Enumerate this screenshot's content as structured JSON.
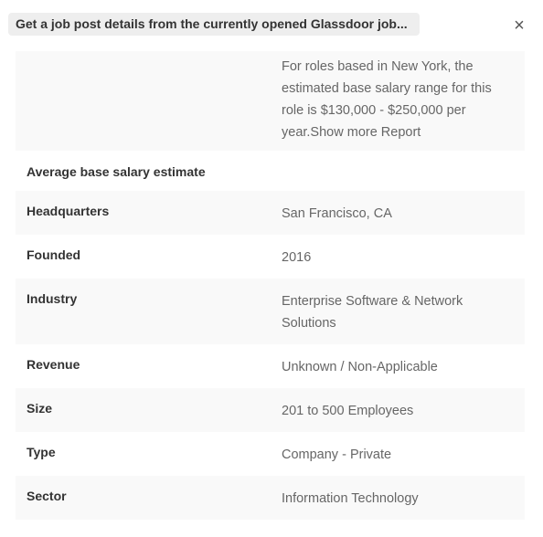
{
  "header": {
    "title": "Get a job post details from the currently opened Glassdoor job...",
    "close_icon": "close-icon"
  },
  "salary": {
    "text": "For roles based in New York, the estimated base salary range for this role is $130,000 - $250,000 per year.Show more Report",
    "line1": "For roles based in New York, the",
    "line2": "estimated base salary range for this",
    "line3": "role is $130,000 - $250,000 per",
    "line4": "year.Show more Report"
  },
  "section_label": "Average base salary estimate",
  "company": {
    "rows": [
      {
        "label": "Headquarters",
        "value": "San Francisco, CA"
      },
      {
        "label": "Founded",
        "value": "2016"
      },
      {
        "label": "Industry",
        "value_line1": "Enterprise Software & Network",
        "value_line2": "Solutions"
      },
      {
        "label": "Revenue",
        "value": "Unknown / Non-Applicable"
      },
      {
        "label": "Size",
        "value": "201 to 500 Employees"
      },
      {
        "label": "Type",
        "value": "Company - Private"
      },
      {
        "label": "Sector",
        "value": "Information Technology"
      }
    ]
  },
  "colors": {
    "chip_bg": "#eeeeee",
    "row_shade": "#f9f9f9",
    "label_text": "#333333",
    "value_text": "#666666"
  }
}
